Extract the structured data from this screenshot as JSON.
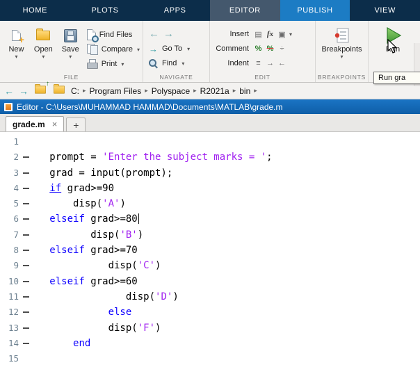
{
  "ribbon": {
    "tabs": [
      {
        "label": "HOME",
        "state": "normal"
      },
      {
        "label": "PLOTS",
        "state": "normal"
      },
      {
        "label": "APPS",
        "state": "normal"
      },
      {
        "label": "EDITOR",
        "state": "active"
      },
      {
        "label": "PUBLISH",
        "state": "highlight"
      },
      {
        "label": "VIEW",
        "state": "normal"
      }
    ],
    "file": {
      "label": "FILE",
      "new": "New",
      "open": "Open",
      "save": "Save",
      "find_files": "Find Files",
      "compare": "Compare",
      "print": "Print"
    },
    "navigate": {
      "label": "NAVIGATE",
      "goto": "Go To",
      "find": "Find"
    },
    "edit": {
      "label": "EDIT",
      "insert": "Insert",
      "comment": "Comment",
      "indent": "Indent"
    },
    "breakpoints": {
      "label": "BREAKPOINTS",
      "button": "Breakpoints"
    },
    "run": {
      "button": "Run",
      "tooltip": "Run gra"
    }
  },
  "address_bar": {
    "path": [
      "C:",
      "Program Files",
      "Polyspace",
      "R2021a",
      "bin"
    ]
  },
  "editor_window": {
    "title": "Editor - C:\\Users\\MUHAMMAD HAMMAD\\Documents\\MATLAB\\grade.m"
  },
  "document_tabs": {
    "active_tab": "grade.m",
    "close": "×",
    "new_tab": "+"
  },
  "code": {
    "lines": [
      {
        "num": "1",
        "exec": false,
        "tokens": []
      },
      {
        "num": "2",
        "exec": true,
        "tokens": [
          {
            "t": "plain",
            "s": "   prompt = "
          },
          {
            "t": "string",
            "s": "'Enter the subject marks = '"
          },
          {
            "t": "plain",
            "s": ";"
          }
        ]
      },
      {
        "num": "3",
        "exec": true,
        "tokens": [
          {
            "t": "plain",
            "s": "   grad = input(prompt);"
          }
        ]
      },
      {
        "num": "4",
        "exec": true,
        "tokens": [
          {
            "t": "plain",
            "s": "   "
          },
          {
            "t": "keyword_u",
            "s": "if"
          },
          {
            "t": "plain",
            "s": " grad>=90"
          }
        ]
      },
      {
        "num": "5",
        "exec": true,
        "tokens": [
          {
            "t": "plain",
            "s": "       disp("
          },
          {
            "t": "string",
            "s": "'A'"
          },
          {
            "t": "plain",
            "s": ")"
          }
        ]
      },
      {
        "num": "6",
        "exec": true,
        "tokens": [
          {
            "t": "plain",
            "s": "   "
          },
          {
            "t": "keyword",
            "s": "elseif"
          },
          {
            "t": "plain",
            "s": " grad>=80"
          },
          {
            "t": "caret",
            "s": ""
          }
        ]
      },
      {
        "num": "7",
        "exec": true,
        "tokens": [
          {
            "t": "plain",
            "s": "          disp("
          },
          {
            "t": "string",
            "s": "'B'"
          },
          {
            "t": "plain",
            "s": ")"
          }
        ]
      },
      {
        "num": "8",
        "exec": true,
        "tokens": [
          {
            "t": "plain",
            "s": "   "
          },
          {
            "t": "keyword",
            "s": "elseif"
          },
          {
            "t": "plain",
            "s": " grad>=70"
          }
        ]
      },
      {
        "num": "9",
        "exec": true,
        "tokens": [
          {
            "t": "plain",
            "s": "             disp("
          },
          {
            "t": "string",
            "s": "'C'"
          },
          {
            "t": "plain",
            "s": ")"
          }
        ]
      },
      {
        "num": "10",
        "exec": true,
        "tokens": [
          {
            "t": "plain",
            "s": "   "
          },
          {
            "t": "keyword",
            "s": "elseif"
          },
          {
            "t": "plain",
            "s": " grad>=60"
          }
        ]
      },
      {
        "num": "11",
        "exec": true,
        "tokens": [
          {
            "t": "plain",
            "s": "                disp("
          },
          {
            "t": "string",
            "s": "'D'"
          },
          {
            "t": "plain",
            "s": ")"
          }
        ]
      },
      {
        "num": "12",
        "exec": true,
        "tokens": [
          {
            "t": "plain",
            "s": "             "
          },
          {
            "t": "keyword",
            "s": "else"
          }
        ]
      },
      {
        "num": "13",
        "exec": true,
        "tokens": [
          {
            "t": "plain",
            "s": "             disp("
          },
          {
            "t": "string",
            "s": "'F'"
          },
          {
            "t": "plain",
            "s": ")"
          }
        ]
      },
      {
        "num": "14",
        "exec": true,
        "tokens": [
          {
            "t": "plain",
            "s": "       "
          },
          {
            "t": "keyword",
            "s": "end"
          }
        ]
      },
      {
        "num": "15",
        "exec": false,
        "tokens": []
      }
    ]
  },
  "colors": {
    "ribbon_bg": "#0C2D4A",
    "active_tab": "#44586D",
    "highlight_tab": "#1C7CC4",
    "title_bar": "#1467B3",
    "keyword": "#0D00FF",
    "string": "#A020F0",
    "run_green": "#4CAF50"
  }
}
